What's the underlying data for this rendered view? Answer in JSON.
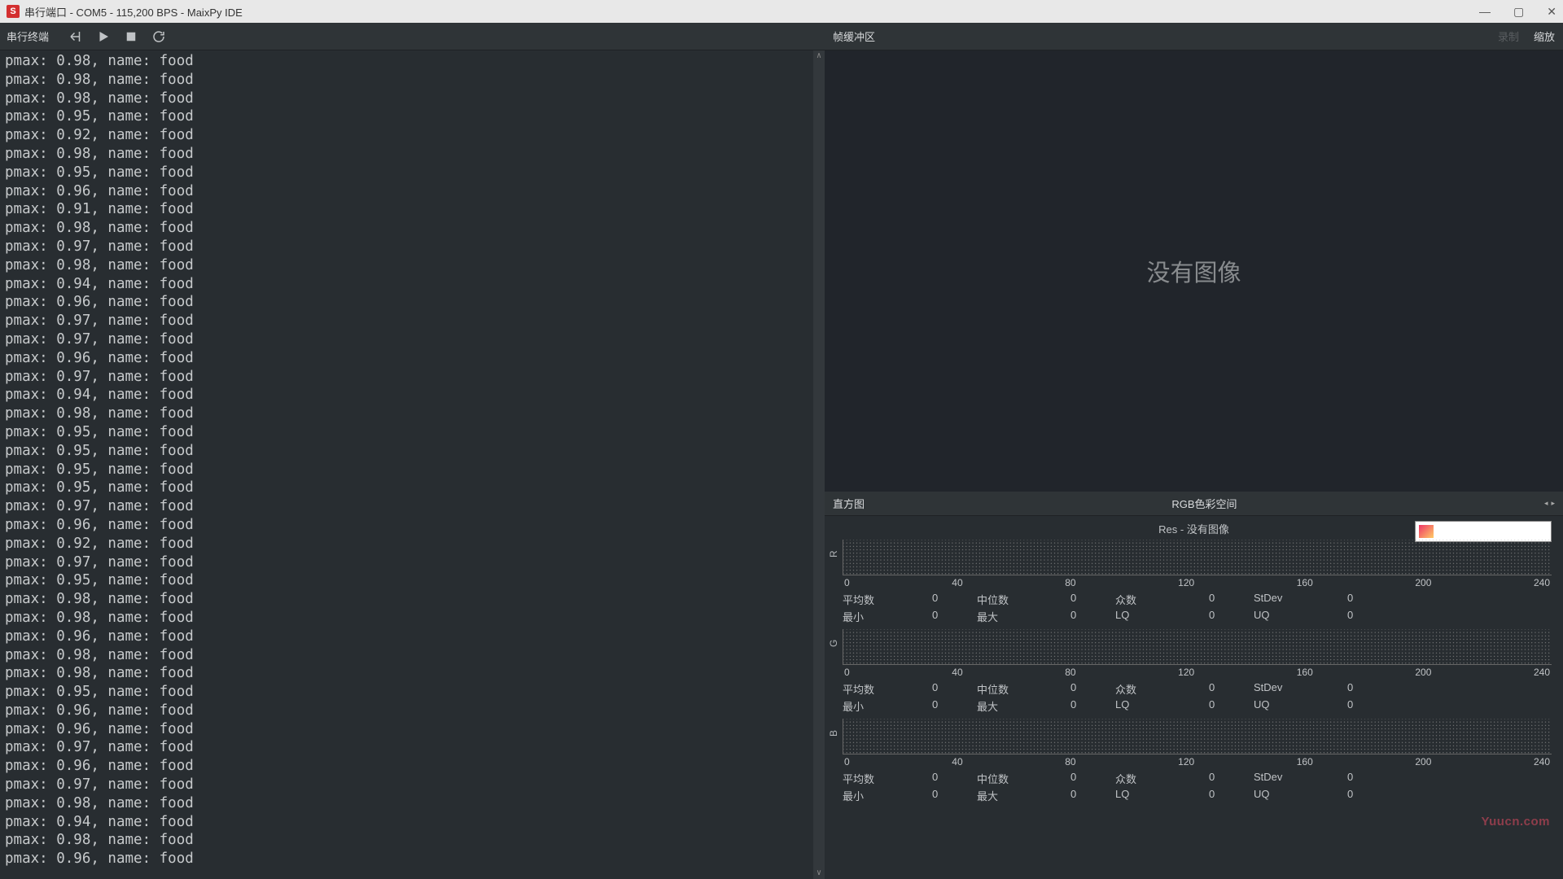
{
  "titlebar": {
    "app_icon": "S",
    "title": "串行端口 - COM5 - 115,200 BPS - MaixPy IDE"
  },
  "toolbar": {
    "label": "串行终端"
  },
  "terminal_lines": [
    "pmax: 0.98, name: food",
    "pmax: 0.98, name: food",
    "pmax: 0.98, name: food",
    "pmax: 0.95, name: food",
    "pmax: 0.92, name: food",
    "pmax: 0.98, name: food",
    "pmax: 0.95, name: food",
    "pmax: 0.96, name: food",
    "pmax: 0.91, name: food",
    "pmax: 0.98, name: food",
    "pmax: 0.97, name: food",
    "pmax: 0.98, name: food",
    "pmax: 0.94, name: food",
    "pmax: 0.96, name: food",
    "pmax: 0.97, name: food",
    "pmax: 0.97, name: food",
    "pmax: 0.96, name: food",
    "pmax: 0.97, name: food",
    "pmax: 0.94, name: food",
    "pmax: 0.98, name: food",
    "pmax: 0.95, name: food",
    "pmax: 0.95, name: food",
    "pmax: 0.95, name: food",
    "pmax: 0.95, name: food",
    "pmax: 0.97, name: food",
    "pmax: 0.96, name: food",
    "pmax: 0.92, name: food",
    "pmax: 0.97, name: food",
    "pmax: 0.95, name: food",
    "pmax: 0.98, name: food",
    "pmax: 0.98, name: food",
    "pmax: 0.96, name: food",
    "pmax: 0.98, name: food",
    "pmax: 0.98, name: food",
    "pmax: 0.95, name: food",
    "pmax: 0.96, name: food",
    "pmax: 0.96, name: food",
    "pmax: 0.97, name: food",
    "pmax: 0.96, name: food",
    "pmax: 0.97, name: food",
    "pmax: 0.98, name: food",
    "pmax: 0.94, name: food",
    "pmax: 0.98, name: food",
    "pmax: 0.96, name: food"
  ],
  "frame_buffer": {
    "header": "帧缓冲区",
    "record_btn": "录制",
    "zoom_btn": "缩放",
    "no_image": "没有图像"
  },
  "histogram": {
    "header": "直方图",
    "colorspace": "RGB色彩空间",
    "title": "Res  - 没有图像",
    "axis_ticks": [
      "0",
      "40",
      "80",
      "120",
      "160",
      "200",
      "240"
    ],
    "channels": [
      {
        "label": "R"
      },
      {
        "label": "G"
      },
      {
        "label": "B"
      }
    ],
    "stat_rows": [
      [
        {
          "lbl": "平均数",
          "val": "0"
        },
        {
          "lbl": "中位数",
          "val": "0"
        },
        {
          "lbl": "众数",
          "val": "0"
        },
        {
          "lbl": "StDev",
          "val": "0"
        }
      ],
      [
        {
          "lbl": "最小",
          "val": "0"
        },
        {
          "lbl": "最大",
          "val": "0"
        },
        {
          "lbl": "LQ",
          "val": "0"
        },
        {
          "lbl": "UQ",
          "val": "0"
        }
      ]
    ]
  },
  "watermark": "Yuucn.com",
  "chart_data": [
    {
      "type": "bar",
      "title": "R histogram - 没有图像",
      "categories": [
        0,
        40,
        80,
        120,
        160,
        200,
        240
      ],
      "values": [
        0,
        0,
        0,
        0,
        0,
        0,
        0
      ],
      "xlabel": "",
      "ylabel": "",
      "ylim": [
        0,
        1
      ],
      "stats": {
        "mean": 0,
        "median": 0,
        "mode": 0,
        "stdev": 0,
        "min": 0,
        "max": 0,
        "lq": 0,
        "uq": 0
      }
    },
    {
      "type": "bar",
      "title": "G histogram - 没有图像",
      "categories": [
        0,
        40,
        80,
        120,
        160,
        200,
        240
      ],
      "values": [
        0,
        0,
        0,
        0,
        0,
        0,
        0
      ],
      "xlabel": "",
      "ylabel": "",
      "ylim": [
        0,
        1
      ],
      "stats": {
        "mean": 0,
        "median": 0,
        "mode": 0,
        "stdev": 0,
        "min": 0,
        "max": 0,
        "lq": 0,
        "uq": 0
      }
    },
    {
      "type": "bar",
      "title": "B histogram - 没有图像",
      "categories": [
        0,
        40,
        80,
        120,
        160,
        200,
        240
      ],
      "values": [
        0,
        0,
        0,
        0,
        0,
        0,
        0
      ],
      "xlabel": "",
      "ylabel": "",
      "ylim": [
        0,
        1
      ],
      "stats": {
        "mean": 0,
        "median": 0,
        "mode": 0,
        "stdev": 0,
        "min": 0,
        "max": 0,
        "lq": 0,
        "uq": 0
      }
    }
  ]
}
